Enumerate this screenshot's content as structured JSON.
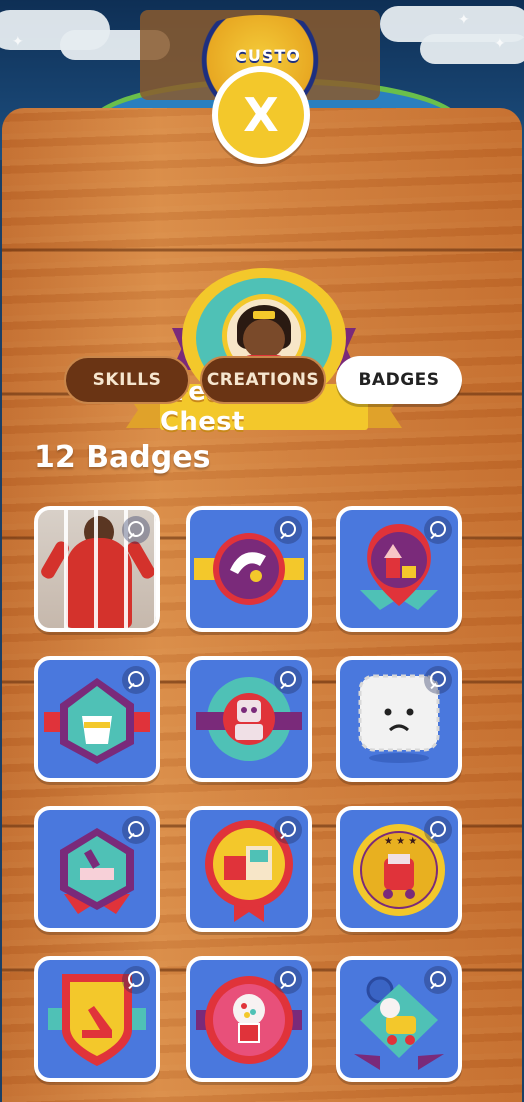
{
  "scene": {
    "sign_text": "CUSTO"
  },
  "modal": {
    "close_label": "X",
    "title": "Treasure Chest",
    "tabs": [
      {
        "label": "SKILLS",
        "active": false
      },
      {
        "label": "CREATIONS",
        "active": false
      },
      {
        "label": "BADGES",
        "active": true
      }
    ],
    "badge_count_label": "12 Badges"
  },
  "badges": [
    {
      "icon": "celebration-photo"
    },
    {
      "icon": "bubbles-badge"
    },
    {
      "icon": "block-tower-badge"
    },
    {
      "icon": "sand-bucket-badge"
    },
    {
      "icon": "robot-badge"
    },
    {
      "icon": "sad-cloud-badge"
    },
    {
      "icon": "music-blocks-badge"
    },
    {
      "icon": "building-blocks-badge"
    },
    {
      "icon": "toy-car-badge"
    },
    {
      "icon": "crane-badge"
    },
    {
      "icon": "gumball-machine-badge"
    },
    {
      "icon": "toy-dog-badge"
    }
  ],
  "colors": {
    "accent_yellow": "#f3c82b",
    "card_blue": "#4a78dd",
    "tab_brown": "#6a3414",
    "wood": "#cd7a38"
  }
}
